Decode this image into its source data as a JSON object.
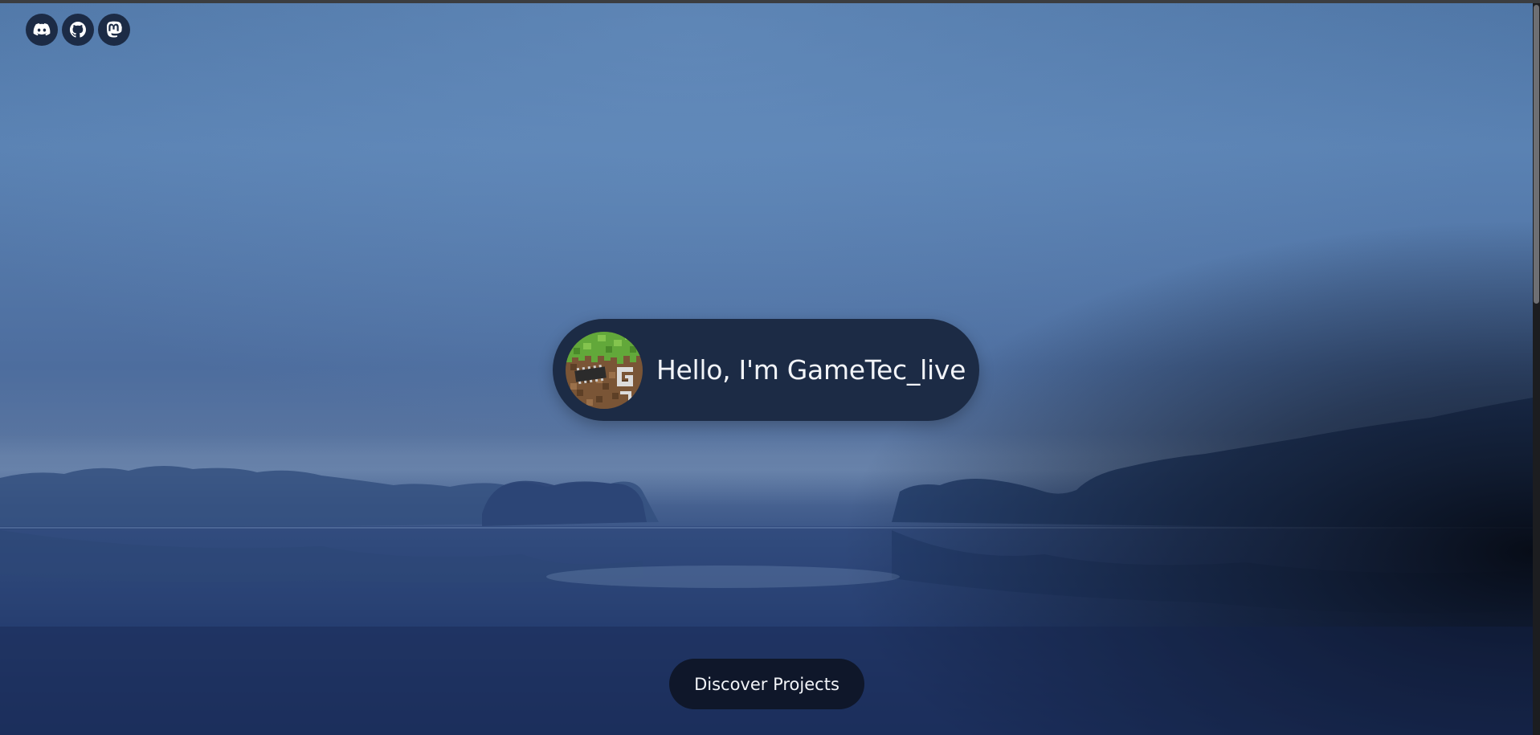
{
  "social_links": [
    {
      "icon": "discord-icon"
    },
    {
      "icon": "github-icon"
    },
    {
      "icon": "mastodon-icon"
    }
  ],
  "hero": {
    "greeting": "Hello, I'm GameTec_live",
    "avatar_icon": "minecraft-grass-block-avatar"
  },
  "cta": {
    "label": "Discover Projects"
  },
  "colors": {
    "pill_background": "#1c2b45",
    "button_background": "#0f172a",
    "text": "#f2f4f8"
  }
}
